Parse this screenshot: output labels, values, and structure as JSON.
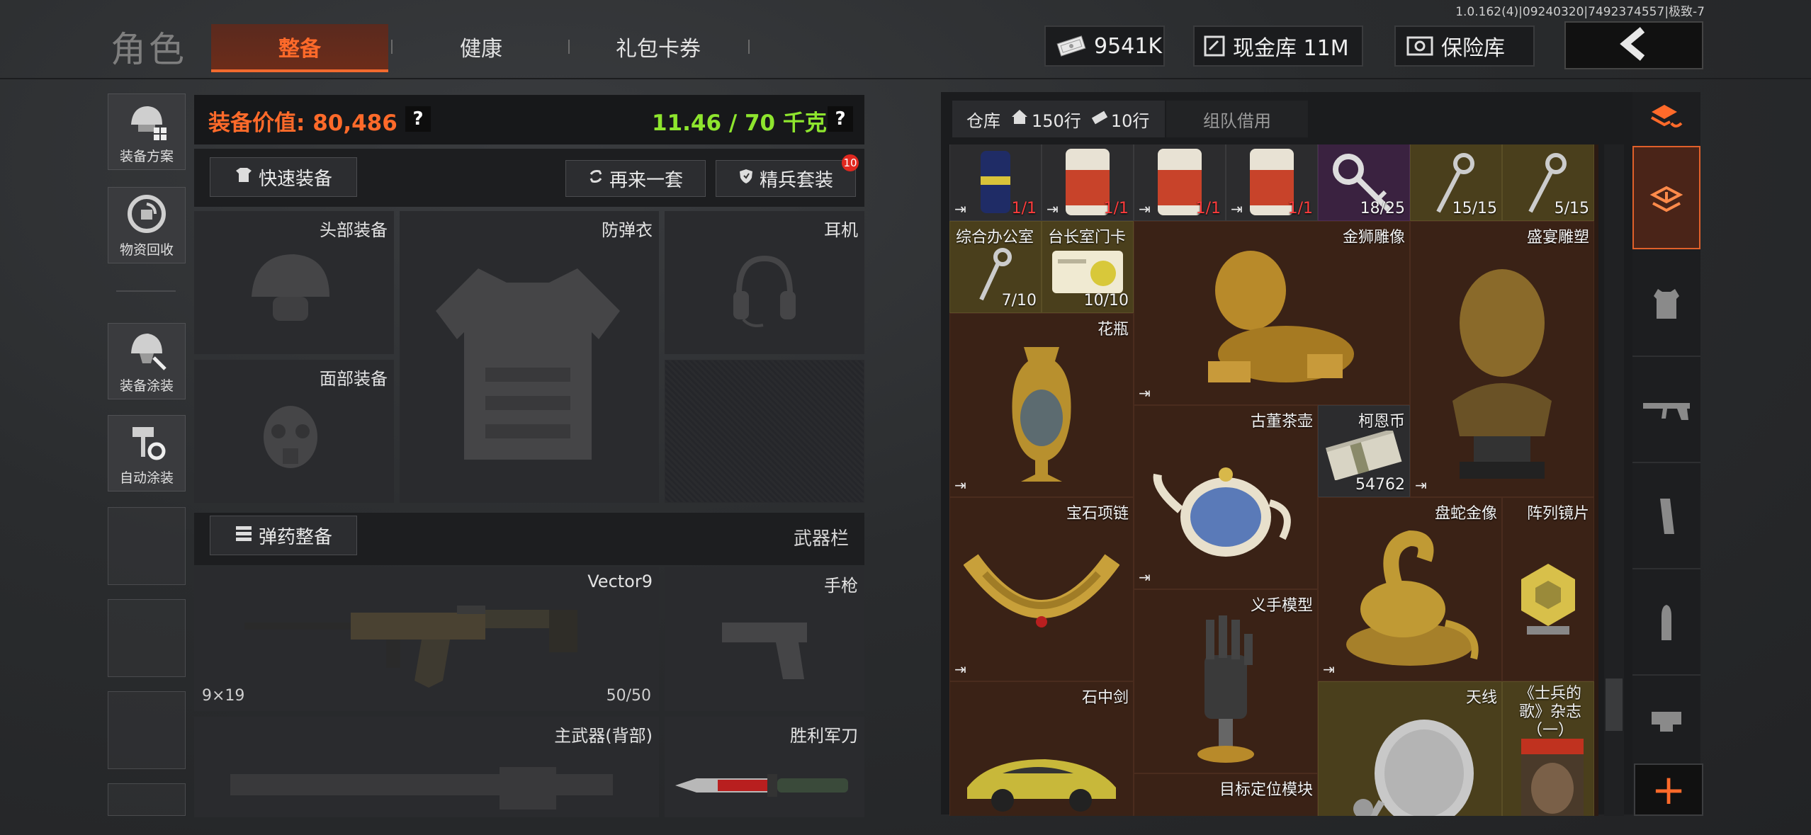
{
  "version": "1.0.162(4)|09240320|7492374557|极致-7",
  "header": {
    "title": "角色",
    "tabs": [
      {
        "label": "整备",
        "active": true
      },
      {
        "label": "健康",
        "active": false
      },
      {
        "label": "礼包卡券",
        "active": false
      }
    ],
    "currency_amount": "9541K",
    "cash_vault_label": "现金库 11M",
    "safe_label": "保险库"
  },
  "sidebar": {
    "items": [
      {
        "label": "装备方案",
        "icon": "helmet-plan-icon"
      },
      {
        "label": "物资回收",
        "icon": "recycle-icon"
      },
      {
        "label": "装备涂装",
        "icon": "paint-helmet-icon"
      },
      {
        "label": "自动涂装",
        "icon": "auto-paint-icon"
      }
    ]
  },
  "loadout": {
    "value_label": "装备价值: 80,486",
    "weight_label": "11.46 / 70 千克",
    "help": "?",
    "quick_equip": "快速装备",
    "again_set": "再来一套",
    "elite_set": "精兵套装",
    "elite_badge": "10",
    "slots": {
      "head": "头部装备",
      "armor": "防弹衣",
      "headset": "耳机",
      "face": "面部装备"
    },
    "ammo_button": "弹药整备",
    "weapon_bar": "武器栏",
    "primary": {
      "name": "Vector9",
      "caliber": "9×19",
      "ammo": "50/50"
    },
    "pistol": "手枪",
    "back_weapon": "主武器(背部)",
    "knife": "胜利军刀"
  },
  "warehouse": {
    "tab_label": "仓库",
    "rows_home": "150行",
    "rows_ticket": "10行",
    "team_borrow": "组队借用",
    "items": [
      {
        "name": "",
        "count": "1/1",
        "color": "dark",
        "count_red": true,
        "art": "can-icon"
      },
      {
        "name": "",
        "count": "1/1",
        "color": "dark",
        "count_red": true,
        "art": "jar-icon"
      },
      {
        "name": "",
        "count": "1/1",
        "color": "dark",
        "count_red": true,
        "art": "jar-icon"
      },
      {
        "name": "",
        "count": "1/1",
        "color": "dark",
        "count_red": true,
        "art": "jar-icon"
      },
      {
        "name": "",
        "count": "18/25",
        "color": "purple",
        "count_red": false,
        "art": "key-icon"
      },
      {
        "name": "",
        "count": "15/15",
        "color": "yellow",
        "count_red": false,
        "art": "key-icon"
      },
      {
        "name": "",
        "count": "5/15",
        "color": "yellow",
        "count_red": false,
        "art": "key-icon"
      },
      {
        "name": "综合办公室",
        "count": "7/10",
        "color": "yellow",
        "art": "key-icon"
      },
      {
        "name": "台长室门卡",
        "count": "10/10",
        "color": "yellow",
        "art": "keycard-icon"
      },
      {
        "name": "金狮雕像",
        "count": "",
        "color": "brown",
        "art": "lion-statue-icon"
      },
      {
        "name": "盛宴雕塑",
        "count": "",
        "color": "brown",
        "art": "bust-icon"
      },
      {
        "name": "花瓶",
        "count": "",
        "color": "brown",
        "art": "vase-icon"
      },
      {
        "name": "古董茶壶",
        "count": "",
        "color": "brown",
        "art": "teapot-icon"
      },
      {
        "name": "柯恩币",
        "count": "54762",
        "color": "dark",
        "art": "cash-stack-icon"
      },
      {
        "name": "宝石项链",
        "count": "",
        "color": "brown",
        "art": "necklace-icon"
      },
      {
        "name": "盘蛇金像",
        "count": "",
        "color": "brown",
        "art": "snake-statue-icon"
      },
      {
        "name": "阵列镜片",
        "count": "",
        "color": "brown",
        "art": "mirror-array-icon"
      },
      {
        "name": "义手模型",
        "count": "",
        "color": "brown",
        "art": "robot-hand-icon"
      },
      {
        "name": "石中剑",
        "count": "",
        "color": "brown",
        "art": "car-model-icon"
      },
      {
        "name": "天线",
        "count": "",
        "color": "yellow",
        "art": "satellite-dish-icon"
      },
      {
        "name": "《士兵的歌》杂志（一）",
        "count": "",
        "color": "yellow",
        "art": "magazine-icon"
      },
      {
        "name": "目标定位模块",
        "count": "",
        "color": "brown",
        "art": "module-icon"
      }
    ]
  },
  "categories": [
    "stack-refresh-icon",
    "backpack-icon",
    "vest-icon",
    "rifle-icon",
    "magazine-clip-icon",
    "bullet-icon",
    "scope-icon"
  ],
  "plus": "+",
  "colors": {
    "accent": "#ff6a2a",
    "weight_green": "#8ee52e",
    "badge_red": "#e0281f"
  }
}
